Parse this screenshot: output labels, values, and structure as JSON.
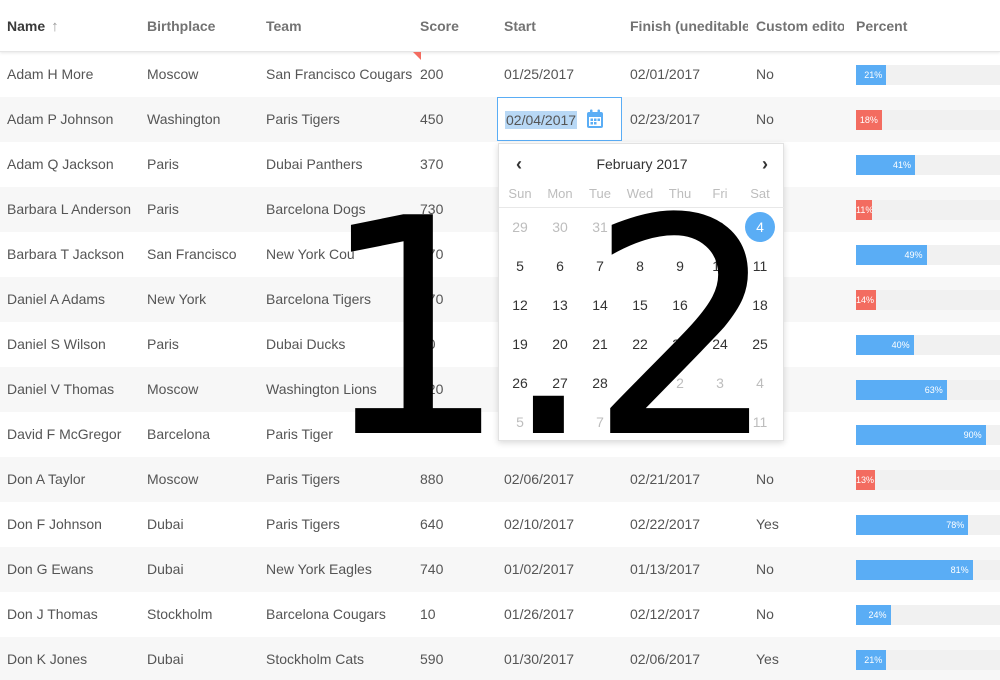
{
  "columns": [
    {
      "label": "Name",
      "sorted": true
    },
    {
      "label": "Birthplace"
    },
    {
      "label": "Team"
    },
    {
      "label": "Score"
    },
    {
      "label": "Start"
    },
    {
      "label": "Finish (uneditable"
    },
    {
      "label": "Custom editor"
    },
    {
      "label": "Percent"
    }
  ],
  "sort_icon": "↑",
  "rows": [
    {
      "name": "Adam H More",
      "birthplace": "Moscow",
      "team": "San Francisco Cougars",
      "score": "200",
      "start": "01/25/2017",
      "finish": "02/01/2017",
      "custom": "No",
      "percent": 21,
      "percent_label": "21%"
    },
    {
      "name": "Adam P Johnson",
      "birthplace": "Washington",
      "team": "Paris Tigers",
      "score": "450",
      "start": "",
      "finish": "02/23/2017",
      "custom": "No",
      "percent": 18,
      "percent_label": "18%"
    },
    {
      "name": "Adam Q Jackson",
      "birthplace": "Paris",
      "team": "Dubai Panthers",
      "score": "370",
      "start": "",
      "finish": "",
      "custom": "",
      "percent": 41,
      "percent_label": "41%"
    },
    {
      "name": "Barbara L Anderson",
      "birthplace": "Paris",
      "team": "Barcelona Dogs",
      "score": "730",
      "start": "",
      "finish": "",
      "custom": "",
      "percent": 11,
      "percent_label": "11%"
    },
    {
      "name": "Barbara T Jackson",
      "birthplace": "San Francisco",
      "team": "New York Cou",
      "score": "370",
      "start": "",
      "finish": "",
      "custom": "",
      "percent": 49,
      "percent_label": "49%"
    },
    {
      "name": "Daniel A Adams",
      "birthplace": "New York",
      "team": "Barcelona Tigers",
      "score": "470",
      "start": "",
      "finish": "",
      "custom": "",
      "percent": 14,
      "percent_label": "14%"
    },
    {
      "name": "Daniel S Wilson",
      "birthplace": "Paris",
      "team": "Dubai Ducks",
      "score": "80",
      "start": "",
      "finish": "",
      "custom": "",
      "percent": 40,
      "percent_label": "40%"
    },
    {
      "name": "Daniel V Thomas",
      "birthplace": "Moscow",
      "team": "Washington Lions",
      "score": "620",
      "start": "",
      "finish": "",
      "custom": "",
      "percent": 63,
      "percent_label": "63%"
    },
    {
      "name": "David F McGregor",
      "birthplace": "Barcelona",
      "team": "Paris Tiger",
      "score": "",
      "start": "",
      "finish": "",
      "custom": "",
      "percent": 90,
      "percent_label": "90%"
    },
    {
      "name": "Don A Taylor",
      "birthplace": "Moscow",
      "team": "Paris Tigers",
      "score": "880",
      "start": "02/06/2017",
      "finish": "02/21/2017",
      "custom": "No",
      "percent": 13,
      "percent_label": "13%"
    },
    {
      "name": "Don F Johnson",
      "birthplace": "Dubai",
      "team": "Paris Tigers",
      "score": "640",
      "start": "02/10/2017",
      "finish": "02/22/2017",
      "custom": "Yes",
      "percent": 78,
      "percent_label": "78%"
    },
    {
      "name": "Don G Ewans",
      "birthplace": "Dubai",
      "team": "New York Eagles",
      "score": "740",
      "start": "01/02/2017",
      "finish": "01/13/2017",
      "custom": "No",
      "percent": 81,
      "percent_label": "81%"
    },
    {
      "name": "Don J Thomas",
      "birthplace": "Stockholm",
      "team": "Barcelona Cougars",
      "score": "10",
      "start": "01/26/2017",
      "finish": "02/12/2017",
      "custom": "No",
      "percent": 24,
      "percent_label": "24%"
    },
    {
      "name": "Don K Jones",
      "birthplace": "Dubai",
      "team": "Stockholm Cats",
      "score": "590",
      "start": "01/30/2017",
      "finish": "02/06/2017",
      "custom": "Yes",
      "percent": 21,
      "percent_label": "21%"
    }
  ],
  "editor": {
    "value": "02/04/2017",
    "icon": "calendar-icon"
  },
  "datepicker": {
    "prev": "‹",
    "next": "›",
    "title": "February 2017",
    "weekdays": [
      "Sun",
      "Mon",
      "Tue",
      "Wed",
      "Thu",
      "Fri",
      "Sat"
    ],
    "weeks": [
      [
        {
          "d": "29",
          "other": true
        },
        {
          "d": "30",
          "other": true
        },
        {
          "d": "31",
          "other": true
        },
        {
          "d": "1"
        },
        {
          "d": "2"
        },
        {
          "d": "3"
        },
        {
          "d": "4",
          "selected": true
        }
      ],
      [
        {
          "d": "5"
        },
        {
          "d": "6"
        },
        {
          "d": "7"
        },
        {
          "d": "8"
        },
        {
          "d": "9"
        },
        {
          "d": "10"
        },
        {
          "d": "11"
        }
      ],
      [
        {
          "d": "12"
        },
        {
          "d": "13"
        },
        {
          "d": "14"
        },
        {
          "d": "15"
        },
        {
          "d": "16"
        },
        {
          "d": "17"
        },
        {
          "d": "18"
        }
      ],
      [
        {
          "d": "19"
        },
        {
          "d": "20"
        },
        {
          "d": "21"
        },
        {
          "d": "22"
        },
        {
          "d": "23"
        },
        {
          "d": "24"
        },
        {
          "d": "25"
        }
      ],
      [
        {
          "d": "26"
        },
        {
          "d": "27"
        },
        {
          "d": "28"
        },
        {
          "d": "1",
          "other": true
        },
        {
          "d": "2",
          "other": true
        },
        {
          "d": "3",
          "other": true
        },
        {
          "d": "4",
          "other": true
        }
      ],
      [
        {
          "d": "5",
          "other": true
        },
        {
          "d": "6",
          "other": true
        },
        {
          "d": "7",
          "other": true
        },
        {
          "d": "8",
          "other": true
        },
        {
          "d": "9",
          "other": true
        },
        {
          "d": "10",
          "other": true
        },
        {
          "d": "11",
          "other": true
        }
      ]
    ]
  },
  "overlay": {
    "text": "1.2"
  },
  "colors": {
    "accent": "#5aadf5",
    "low": "#f36c60",
    "row_alt": "#f7f7f7",
    "selection": "#b8d8f5"
  }
}
